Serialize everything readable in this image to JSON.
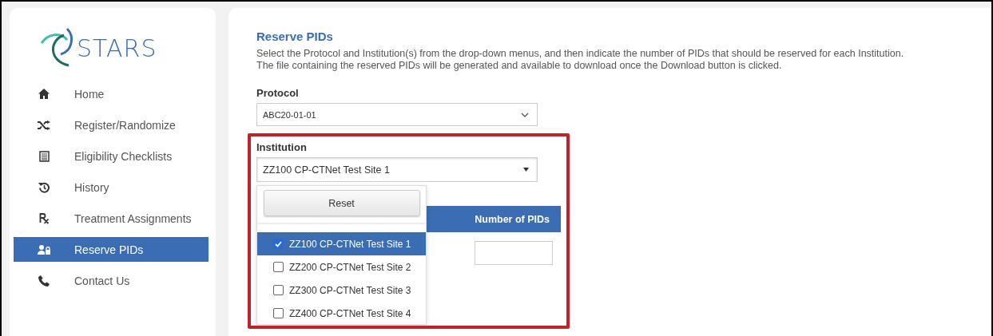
{
  "logo": {
    "text": "STARS"
  },
  "sidebar": {
    "items": [
      {
        "label": "Home",
        "selected": false
      },
      {
        "label": "Register/Randomize",
        "selected": false
      },
      {
        "label": "Eligibility Checklists",
        "selected": false
      },
      {
        "label": "History",
        "selected": false
      },
      {
        "label": "Treatment Assignments",
        "selected": false
      },
      {
        "label": "Reserve PIDs",
        "selected": true
      },
      {
        "label": "Contact Us",
        "selected": false
      }
    ]
  },
  "page": {
    "title": "Reserve PIDs",
    "description": [
      "Select the Protocol and Institution(s) from the drop-down menus, and then indicate the number of PIDs that should be reserved for each Institution.",
      "The file containing the reserved PIDs will be generated and available to download once the Download button is clicked."
    ],
    "protocol": {
      "label": "Protocol",
      "value": "ABC20-01-01"
    },
    "institution": {
      "label": "Institution",
      "value": "ZZ100 CP-CTNet Test Site 1",
      "highlighted": true,
      "dropdown": {
        "reset_button": "Reset",
        "options": [
          {
            "label": "ZZ100 CP-CTNet Test Site 1",
            "checked": true,
            "selected": true
          },
          {
            "label": "ZZ200 CP-CTNet Test Site 2",
            "checked": false,
            "selected": false
          },
          {
            "label": "ZZ300 CP-CTNet Test Site 3",
            "checked": false,
            "selected": false
          },
          {
            "label": "ZZ400 CP-CTNet Test Site 4",
            "checked": false,
            "selected": false
          }
        ]
      }
    },
    "table": {
      "columns": [
        "Number of PIDs"
      ]
    }
  }
}
